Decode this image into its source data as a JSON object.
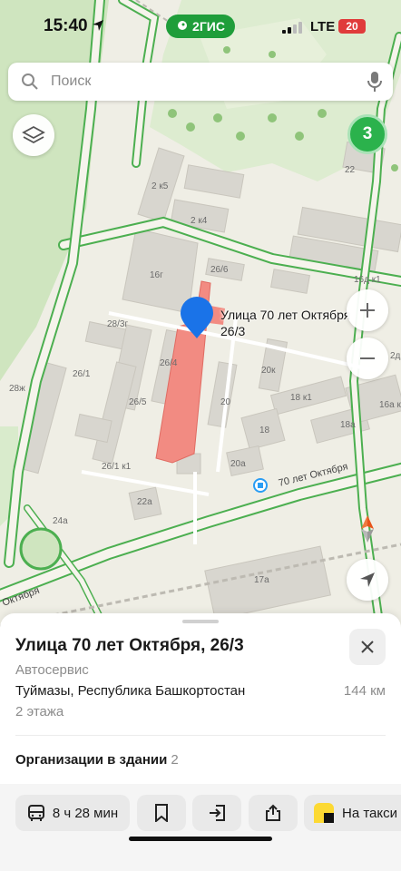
{
  "status_bar": {
    "time": "15:40",
    "network": "LTE",
    "battery": "20"
  },
  "app_badge": "2ГИС",
  "search": {
    "placeholder": "Поиск"
  },
  "map": {
    "cluster_count": "3",
    "pin_label_line1": "Улица 70 лет Октября",
    "pin_label_line2": "26/3",
    "street_name": "70 лет Октября",
    "street_name_left": "Октября",
    "labels": {
      "l2k5": "2 к5",
      "l2k4": "2 к4",
      "l16g": "16г",
      "l26_6": "26/6",
      "l16dk1": "16д к1",
      "l28_3g": "28/3г",
      "l26_4": "26/4",
      "l26_1": "26/1",
      "l26_5": "26/5",
      "l20k": "20к",
      "l18k1": "18 к1",
      "l28zh": "28ж",
      "l20": "20",
      "l18": "18",
      "l18a": "18а",
      "l16ak": "16а к",
      "l26_1k1": "26/1 к1",
      "l20a": "20а",
      "l22a": "22а",
      "l24a": "24а",
      "l17a": "17а",
      "l22": "22",
      "l2d": "2д"
    }
  },
  "sheet": {
    "title": "Улица 70 лет Октября, 26/3",
    "category": "Автосервис",
    "address": "Туймазы, Республика Башкортостан",
    "distance": "144 км",
    "floors": "2 этажа",
    "orgs_label": "Организации в здании",
    "orgs_count": "2"
  },
  "toolbar": {
    "route_time": "8 ч 28 мин",
    "taxi_label": "На такси"
  },
  "colors": {
    "accent_green": "#2bb24c",
    "pin_blue": "#1a73e8",
    "building_highlight": "#f28b82"
  }
}
